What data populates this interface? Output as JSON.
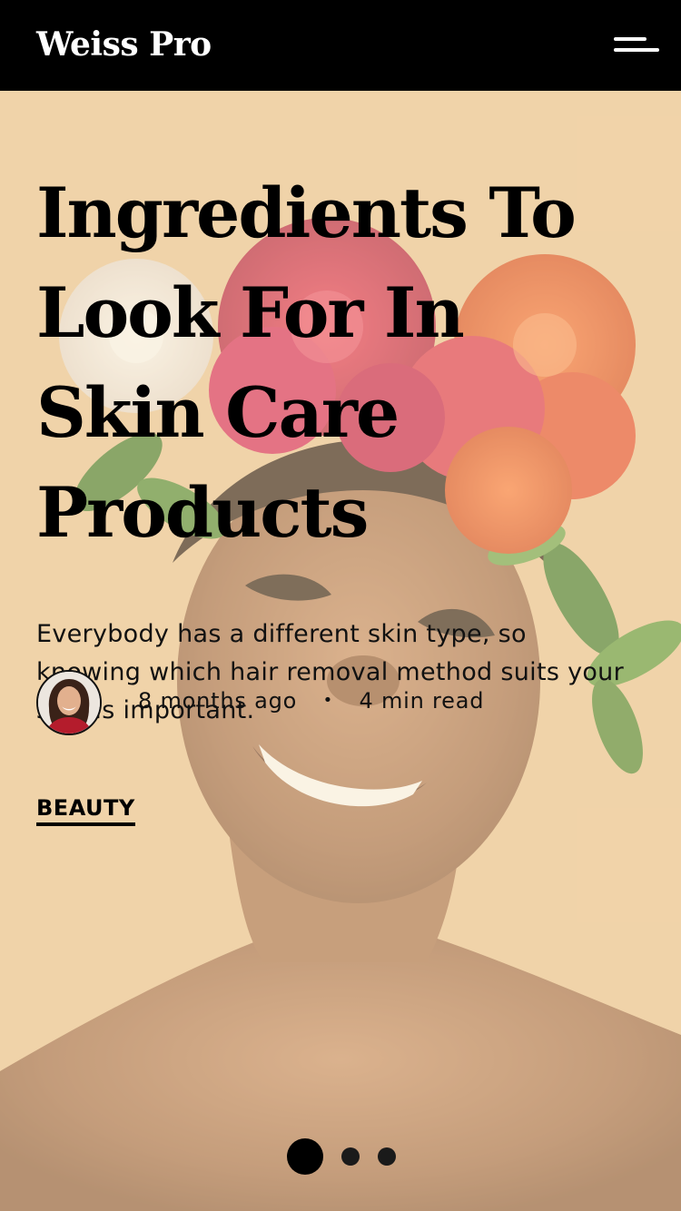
{
  "header": {
    "brand": "Weiss Pro",
    "menu_icon": "hamburger-menu-icon"
  },
  "hero": {
    "image": "woman-with-flower-crown-photo",
    "colors": {
      "background": "#f0d9b0",
      "header": "#000000",
      "text": "#000000"
    }
  },
  "article": {
    "title": "Ingredients To Look For In Skin Care Products",
    "excerpt": "Everybody has a different skin type, so knowing which hair removal method suits your skin is important.",
    "meta": {
      "avatar": "author-avatar",
      "posted": "8 months ago",
      "separator": "•",
      "read_time": "4 min read"
    },
    "category": "BEAUTY"
  },
  "pager": {
    "count": 3,
    "active_index": 0
  }
}
